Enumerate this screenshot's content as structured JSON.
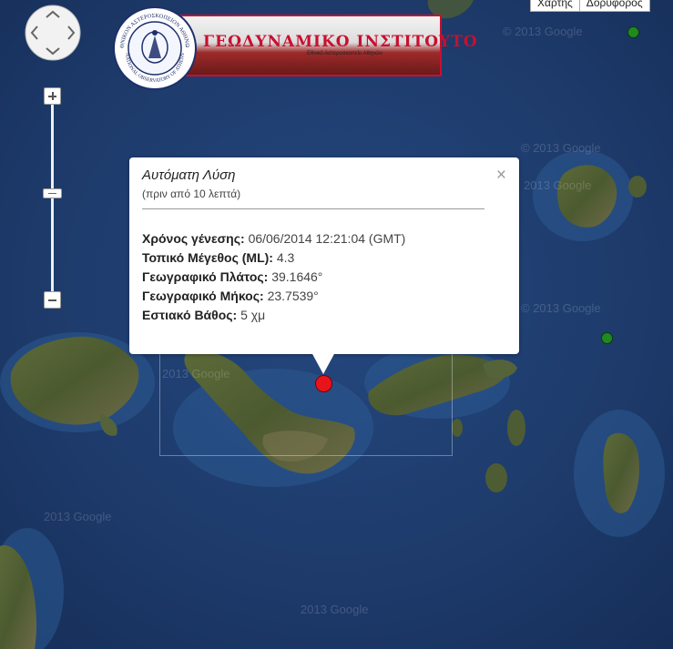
{
  "map_type": {
    "map_label": "Χάρτης",
    "satellite_label": "Δορυφόρος"
  },
  "logo": {
    "title": "ΓΕΩΔΥΝΑΜΙΚΟ ΙΝΣΤΙΤΟΥΤΟ",
    "subtitle": "Εθνικό Αστεροσκοπείο Αθηνών",
    "seal_text": "ΕΘΝΙΚΟΝ ΑΣΤΕΡΟΣΚΟΠΕΙΟΝ ΑΘΗΝΩΝ",
    "seal_text_bottom": "NATIONAL OBSERVATORY OF ATHENS"
  },
  "watermarks": [
    "© 2013 Google",
    "© 2013 Google",
    "© 2013 Google",
    "2013 Google",
    "2013 Google",
    "2013 Google",
    "2013 Google"
  ],
  "popup": {
    "title": "Αυτόματη Λύση",
    "subtitle": "(πριν από 10 λεπτά)",
    "close": "×",
    "origin_time_label": "Χρόνος γένεσης:",
    "origin_time": "06/06/2014  12:21:04 (GMT)",
    "magnitude_label": "Τοπικό Μέγεθος (ML):",
    "magnitude": "4.3",
    "latitude_label": "Γεωγραφικό Πλάτος:",
    "latitude": "39.1646°",
    "longitude_label": "Γεωγραφικό Μήκος:",
    "longitude": "23.7539°",
    "depth_label": "Εστιακό Βάθος:",
    "depth": "5 χμ"
  },
  "colors": {
    "quake_marker": "#e8141b",
    "station_marker": "#1f8a1f",
    "popup_bg": "#ffffff",
    "sea": "#1e3a6b"
  }
}
